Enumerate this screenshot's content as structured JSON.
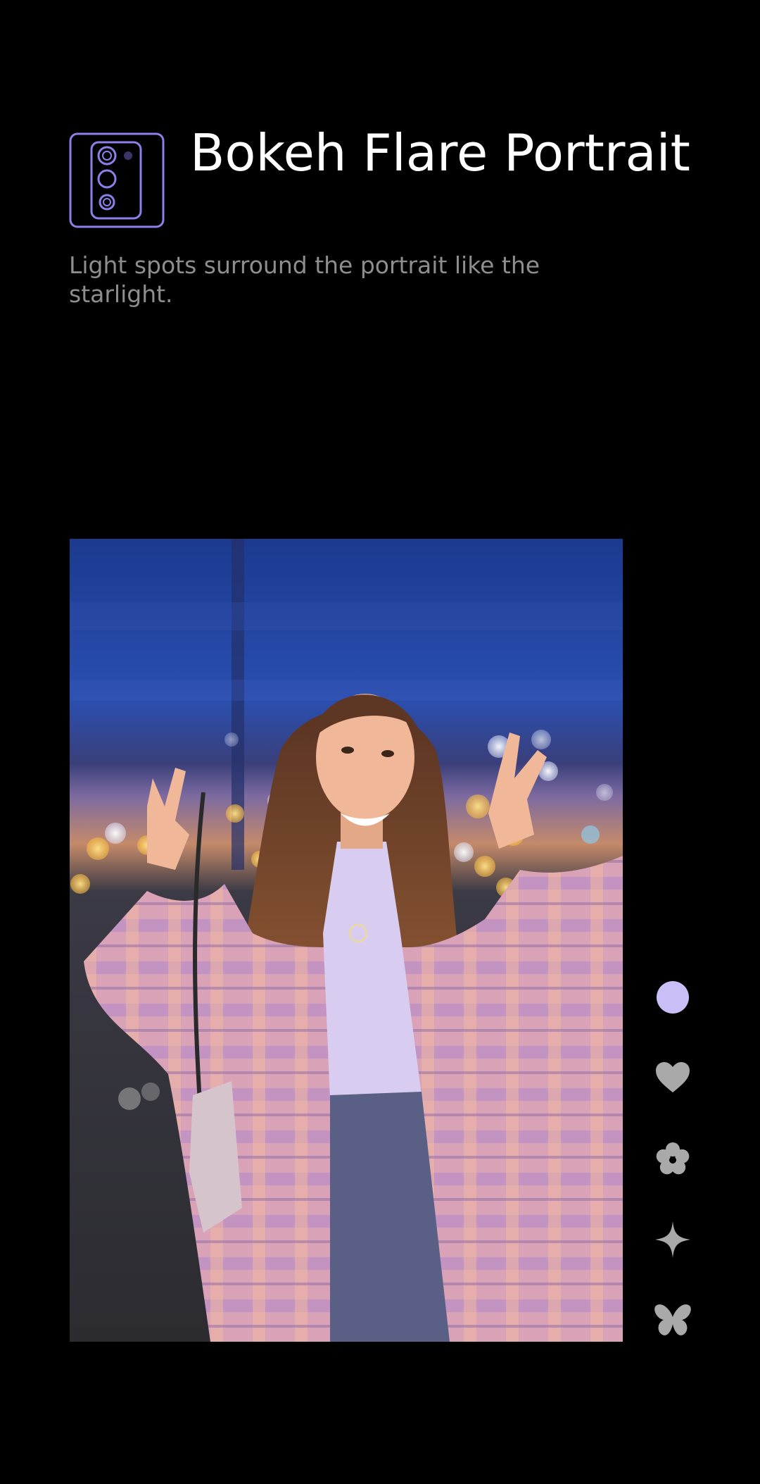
{
  "header": {
    "icon": "camera-module-icon",
    "title": "Bokeh Flare Portrait",
    "description": "Light spots surround the portrait like the starlight."
  },
  "photo": {
    "subject": "portrait-photo-bokeh-flare"
  },
  "effects": [
    {
      "icon": "circle-effect-icon",
      "selected": true
    },
    {
      "icon": "heart-effect-icon",
      "selected": false
    },
    {
      "icon": "flower-effect-icon",
      "selected": false
    },
    {
      "icon": "star-effect-icon",
      "selected": false
    },
    {
      "icon": "butterfly-effect-icon",
      "selected": false
    }
  ],
  "colors": {
    "background": "#000000",
    "accent": "#c9bff6",
    "icon_outline": "#8b80e8",
    "inactive_icon": "#a9a9a9",
    "subtitle": "#8e8e8e"
  }
}
